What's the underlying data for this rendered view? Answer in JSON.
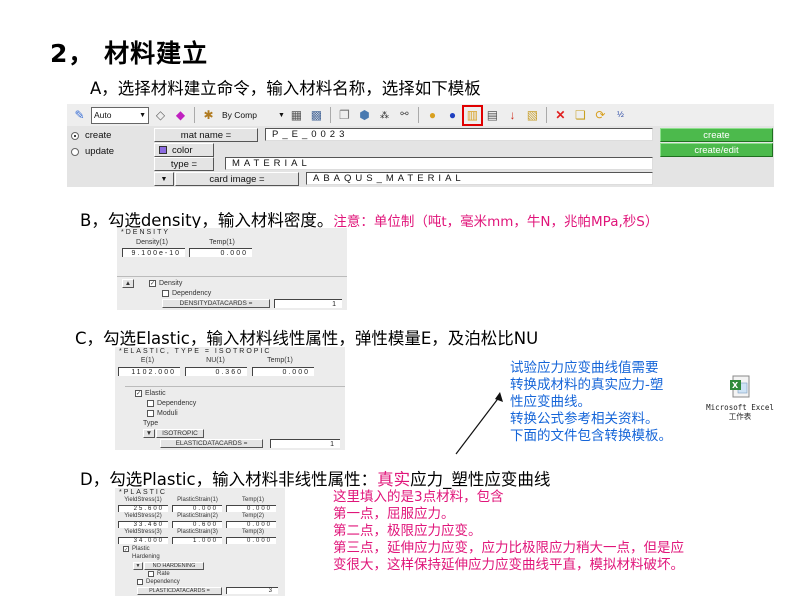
{
  "title": "2， 材料建立",
  "steps": {
    "a": "A，选择材料建立命令，输入材料名称，选择如下模板",
    "b": "B，勾选density，输入材料密度。",
    "b_note": "注意：单位制（吨t，毫米mm，牛N，兆帕MPa,秒S）",
    "c": "C，勾选Elastic，输入材料线性属性，弹性模量E，及泊松比NU",
    "d_prefix": "D，勾选Plastic，输入材料非线性属性：",
    "d_red": "真实",
    "d_suffix": "应力_塑性应变曲线"
  },
  "hm_panel": {
    "toolbar": {
      "display_mode": "Auto",
      "color_mode": "By Comp",
      "icons": [
        "display-mode-icon",
        "shade-icon",
        "shade-color-icon",
        "by-comp-icon",
        "mesh-cube-icon",
        "mesh-cube-shaded-icon",
        "cube-outline-icon",
        "cube-solid-icon",
        "grid-icon",
        "tree-icon",
        "folder-shapes-icon",
        "folder-blue-icon",
        "material-folder-icon",
        "property-card-icon",
        "load-collector-icon",
        "folder-xy-icon",
        "delete-icon",
        "duplicate-icon",
        "folder-refresh-icon",
        "renumber-icon"
      ],
      "highlighted_icon": "material-folder-icon",
      "highlight_color": "#e00000"
    },
    "mode_options": [
      {
        "label": "create",
        "selected": true
      },
      {
        "label": "update",
        "selected": false
      }
    ],
    "mat_name_label": "mat name =",
    "mat_name_value": "P_E_0023",
    "color_label": "color",
    "color_swatch": "#8b6be0",
    "type_label": "type =",
    "type_value": "MATERIAL",
    "card_image_label": "card image =",
    "card_image_value": "ABAQUS_MATERIAL",
    "create_button": "create",
    "create_edit_button": "create/edit",
    "button_color": "#4cba4c"
  },
  "density_panel": {
    "header": "*DENSITY",
    "columns": [
      "Density(1)",
      "Temp(1)"
    ],
    "values": [
      "9.100e-10",
      "0.000"
    ],
    "checkbox_density": "Density",
    "checkbox_dependency": "Dependency",
    "datacards_label": "DENSITYDATACARDS =",
    "datacards_value": "1"
  },
  "elastic_panel": {
    "header": "*ELASTIC, TYPE = ISOTROPIC",
    "columns": [
      "E(1)",
      "NU(1)",
      "Temp(1)"
    ],
    "values": [
      "1102.000",
      "0.360",
      "0.000"
    ],
    "checkbox_elastic": "Elastic",
    "checkbox_dependency": "Dependency",
    "checkbox_moduli": "Moduli",
    "type_label": "Type",
    "type_value": "ISOTROPIC",
    "datacards_label": "ELASTICDATACARDS =",
    "datacards_value": "1"
  },
  "plastic_panel": {
    "header": "*PLASTIC",
    "rows": [
      {
        "labels": [
          "YieldStress(1)",
          "PlasticStrain(1)",
          "Temp(1)"
        ],
        "values": [
          "25.600",
          "0.000",
          "0.000"
        ]
      },
      {
        "labels": [
          "YieldStress(2)",
          "PlasticStrain(2)",
          "Temp(2)"
        ],
        "values": [
          "33.460",
          "0.600",
          "0.000"
        ]
      },
      {
        "labels": [
          "YieldStress(3)",
          "PlasticStrain(3)",
          "Temp(3)"
        ],
        "values": [
          "34.000",
          "1.000",
          "0.000"
        ]
      }
    ],
    "checkbox_plastic": "Plastic",
    "hardening_label": "Hardening",
    "hardening_value": "NO HARDENING",
    "checkbox_rate": "Rate",
    "checkbox_dependency": "Dependency",
    "datacards_label": "PLASTICDATACARDS =",
    "datacards_value": "3"
  },
  "blue_note": {
    "lines": [
      "试验应力应变曲线值需要",
      "转换成材料的真实应力-塑",
      "性应变曲线。",
      "转换公式参考相关资料。",
      "下面的文件包含转换模板。"
    ],
    "color": "#1565d8"
  },
  "excel_file": {
    "line1": "Microsoft Excel",
    "line2": "工作表"
  },
  "pink_note": {
    "lines": [
      "这里填入的是3点材料，包含",
      "第一点，屈服应力。",
      "第二点，极限应力应变。",
      "第三点，延伸应力应变，应力比极限应力稍大一点，但是应",
      "变很大，这样保持延伸应力应变曲线平直，模拟材料破坏。"
    ],
    "color": "#e0157a"
  }
}
